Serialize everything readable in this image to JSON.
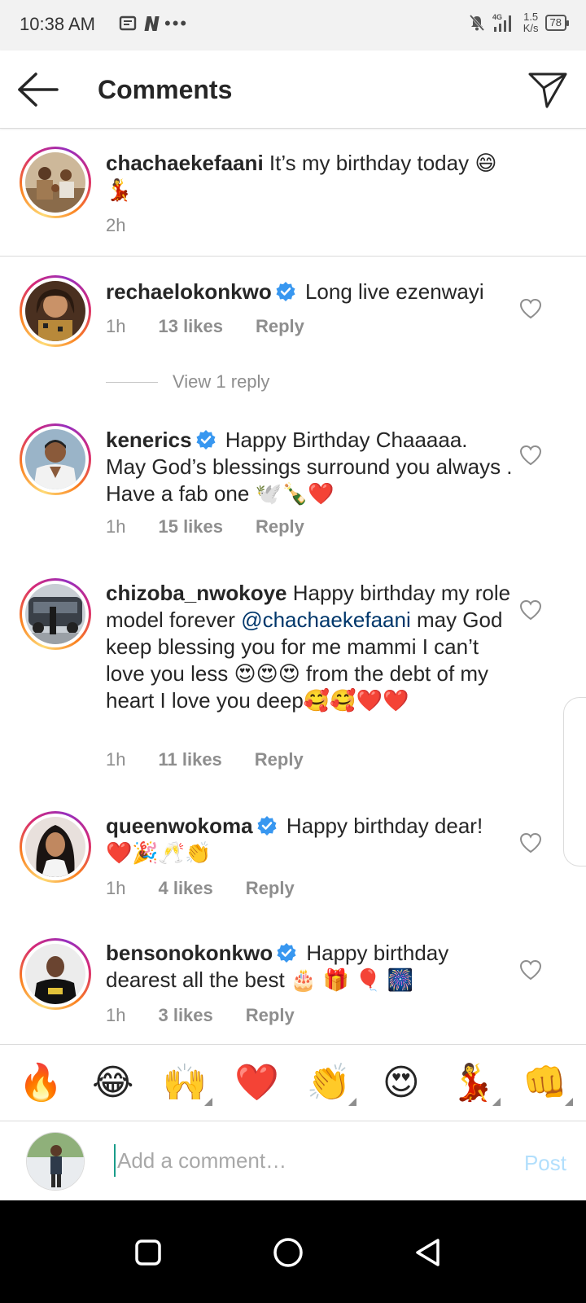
{
  "status_bar": {
    "time": "10:38 AM",
    "left_icons": [
      "message-icon",
      "netflix-n-icon"
    ],
    "more": "•••",
    "network_label": "4G",
    "speed": "1.5",
    "speed_unit": "K/s",
    "battery": "78"
  },
  "header": {
    "title": "Comments"
  },
  "caption": {
    "username": "chachaekefaani",
    "text": "It’s my birthday today 😄 💃",
    "time": "2h"
  },
  "comments": [
    {
      "username": "rechaelokonkwo",
      "verified": true,
      "text": "Long live ezenwayi",
      "time": "1h",
      "likes": "13 likes",
      "reply": "Reply"
    },
    {
      "username": "kenerics",
      "verified": true,
      "text": "Happy Birthday Chaaaaa. May God’s blessings surround you always . Have a fab one 🕊️🍾❤️",
      "time": "1h",
      "likes": "15 likes",
      "reply": "Reply"
    },
    {
      "username": "chizoba_nwokoye",
      "verified": false,
      "text_before": "Happy birthday my role model forever ",
      "mention": "@chachaekefaani",
      "text_after": " may God keep blessing you for me mammi I can’t love you less 😍😍😍 from the debt of my heart I love you deep🥰🥰❤️❤️",
      "time": "1h",
      "likes": "11 likes",
      "reply": "Reply"
    },
    {
      "username": "queenwokoma",
      "verified": true,
      "text": "Happy birthday dear! ❤️🎉🥂👏",
      "time": "1h",
      "likes": "4 likes",
      "reply": "Reply"
    },
    {
      "username": "bensonokonkwo",
      "verified": true,
      "text": "Happy birthday dearest all the best 🎂 🎁 🎈 🎆",
      "time": "1h",
      "likes": "3 likes",
      "reply": "Reply"
    }
  ],
  "view_replies": "View 1 reply",
  "emoji_bar": [
    "🔥",
    "😂",
    "🙌",
    "❤️",
    "👏",
    "😍",
    "💃",
    "👊"
  ],
  "composer": {
    "placeholder": "Add a comment…",
    "post_label": "Post"
  },
  "colors": {
    "link": "#00376b",
    "meta": "#8e8e8e",
    "post_disabled": "#b2dffc",
    "verified_blue": "#3897f0",
    "heart_red": "#ed4956"
  }
}
